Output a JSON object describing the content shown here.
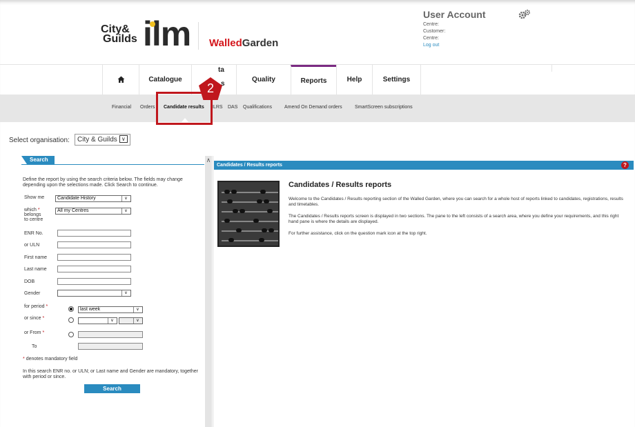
{
  "header": {
    "logo_city_line1": "City&",
    "logo_city_line2": "Guilds",
    "logo_ilm": "ilm",
    "logo_wg_walled": "Walled",
    "logo_wg_garden": "Garden",
    "user_title": "User Account",
    "centre1_label": "Centre:",
    "customer_label": "Customer:",
    "centre2_label": "Centre:",
    "logout_label": "Log out"
  },
  "nav": {
    "home_label": "⌂",
    "items": [
      "Catalogue",
      "Data",
      "Quality",
      "Reports",
      "Help",
      "Settings"
    ],
    "data_partial": "ta",
    "data_partial2": "s"
  },
  "subnav": {
    "items": [
      "Financial",
      "Orders",
      "Candidate results",
      "ILRS",
      "DAS",
      "Qualifications",
      "Amend On Demand orders",
      "SmartScreen subscriptions"
    ]
  },
  "callout": {
    "number": "2",
    "color": "#c0171d"
  },
  "org": {
    "label": "Select organisation:",
    "value": "City & Guilds"
  },
  "search": {
    "tab_label": "Search",
    "description": "Define the report by using the search criteria below. The fields may change depending upon the selections made. Click Search to continue.",
    "show_me_label": "Show me",
    "show_me_value": "Candidate History",
    "which_label_1": "which",
    "which_label_2": "belongs",
    "which_label_3": "to centre",
    "which_value": "All my Centres",
    "enr_label": "ENR No.",
    "uln_label": "or ULN",
    "first_name_label": "First name",
    "last_name_label": "Last name",
    "dob_label": "DOB",
    "gender_label": "Gender",
    "period_label": "for period",
    "period_value": "last week",
    "since_label": "or since",
    "from_label": "or From",
    "to_label": "To",
    "mandatory_note": "denotes mandatory field",
    "rule_note": "In this search ENR no. or ULN; or Last name and Gender are mandatory, together with period or since.",
    "search_button": "Search"
  },
  "report": {
    "header": "Candidates / Results reports",
    "title": "Candidates / Results reports",
    "para1": "Welcome to the Candidates / Results reporting section of the Walled Garden, where you can search for a whole host of reports linked to candidates, registrations, results and timetables.",
    "para2": "The Candidates / Results reports screen is displayed in two sections. The pane to the left consists of a search area, where you define your requirements, and this right hand pane is where the details are displayed.",
    "para3": "For further assistance, click on the question mark icon at the top right.",
    "help_icon": "?"
  },
  "colors": {
    "accent": "#2a8bbf",
    "active_tab": "#7b2a82",
    "brand_red": "#d4161c"
  }
}
